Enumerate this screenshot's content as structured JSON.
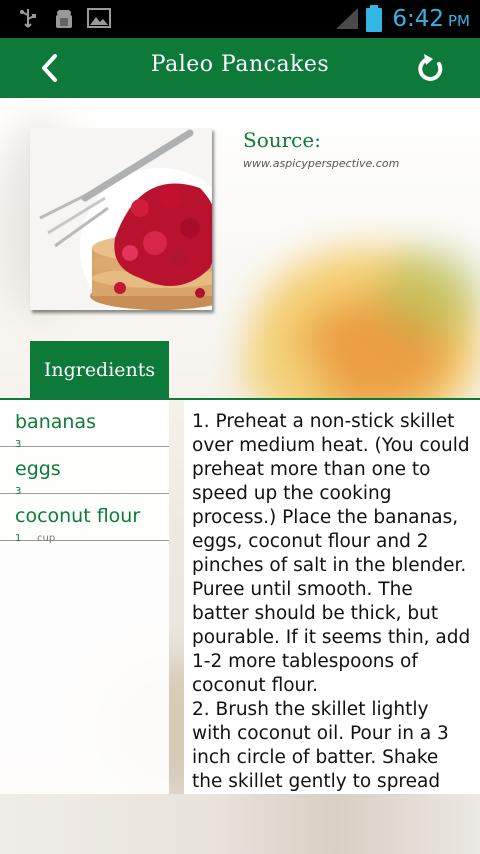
{
  "status_bar": {
    "time": "6:42",
    "ampm": "PM",
    "icons": [
      "usb-icon",
      "android-debug-icon",
      "image-icon",
      "signal-icon",
      "battery-icon"
    ]
  },
  "app_bar": {
    "title": "Paleo Pancakes",
    "back_icon": "chevron-left-icon",
    "refresh_icon": "refresh-icon",
    "color": "#0d7a3a"
  },
  "recipe": {
    "source_label": "Source:",
    "source_url": "www.aspicyperspective.com"
  },
  "tabs": {
    "ingredients_label": "Ingredients"
  },
  "ingredients": [
    {
      "name": "bananas",
      "qty": "3",
      "unit": ""
    },
    {
      "name": "eggs",
      "qty": "3",
      "unit": ""
    },
    {
      "name": "coconut flour",
      "qty": "1",
      "unit": "cup"
    }
  ],
  "directions": "1. Preheat a non-stick skillet over medium heat. (You could preheat more than one to speed up the cooking process.) Place the bananas, eggs, coconut flour and 2 pinches of salt in the blender. Puree until smooth. The batter should be thick, but pourable. If it seems thin, add 1-2 more tablespoons of coconut flour.\n2. Brush the skillet lightly with coconut oil. Pour in a 3 inch circle of batter. Shake the skillet gently to spread the"
}
